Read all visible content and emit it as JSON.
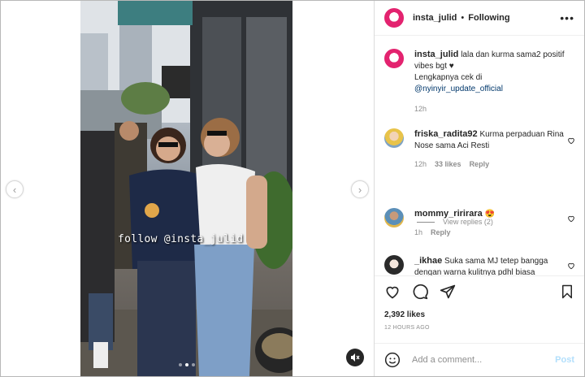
{
  "header": {
    "username": "insta_julid",
    "separator": "•",
    "follow_status": "Following",
    "more_glyph": "•••"
  },
  "media": {
    "watermark": "follow @insta_julid",
    "carousel_total": 3,
    "carousel_active": 2
  },
  "caption": {
    "username": "insta_julid",
    "text": "lala dan kurma sama2 positif vibes bgt ♥",
    "line2": "Lengkapnya cek di",
    "mention": "@nyinyir_update_official",
    "time": "12h"
  },
  "comments": [
    {
      "username": "friska_radita92",
      "text": "Kurma perpaduan Rina Nose sama Aci Resti",
      "time": "12h",
      "likes": "33 likes",
      "reply": "Reply",
      "view_replies": "View replies (2)"
    },
    {
      "username": "mommy_ririrara",
      "text": "😍",
      "time": "1h",
      "reply": "Reply"
    },
    {
      "username": "_ikhae",
      "text": "Suka sama MJ tetep bangga dengan warna kulitnya pdhl biasa"
    }
  ],
  "likes": "2,392 likes",
  "post_time": "12 HOURS AGO",
  "add_comment": {
    "placeholder": "Add a comment...",
    "post_label": "Post"
  },
  "colors": {
    "link": "#00376b",
    "muted": "#8e8e8e",
    "post_disabled": "#b2dffc",
    "avatar_brand": "#e3236f"
  }
}
